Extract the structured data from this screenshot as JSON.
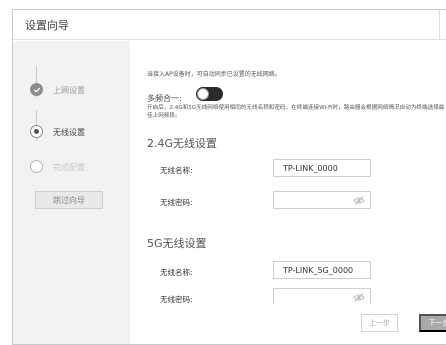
{
  "window": {
    "title": "设置向导"
  },
  "sidebar": {
    "steps": [
      {
        "label": "上网设置",
        "state": "done"
      },
      {
        "label": "无线设置",
        "state": "current"
      },
      {
        "label": "完成配置",
        "state": "todo"
      }
    ],
    "skip_label": "跳过向导"
  },
  "main": {
    "hint": "当接入AP设备时，可自动同步已设置的无线网络。",
    "combo": {
      "label": "多频合一:",
      "enabled": true,
      "description": "开启后，2.4G和5G无线网络使用相同的无线名称和密码，在终端连接Wi-Fi时，路由器会根据网络情况自动为终端选择最佳上网频段。"
    },
    "band_24": {
      "title": "2.4G无线设置",
      "ssid_label": "无线名称:",
      "ssid_value": "TP-LINK_0000",
      "password_label": "无线密码:",
      "password_value": ""
    },
    "band_5": {
      "title": "5G无线设置",
      "ssid_label": "无线名称:",
      "ssid_value": "TP-LINK_5G_0000",
      "password_label": "无线密码:",
      "password_value": ""
    },
    "prev_label": "上一步",
    "next_label": "下一步"
  },
  "colors": {
    "toggle_on": "#2b2b2b",
    "next_button": "#a9a9a9",
    "sidebar_bg": "#f2f2f2"
  }
}
